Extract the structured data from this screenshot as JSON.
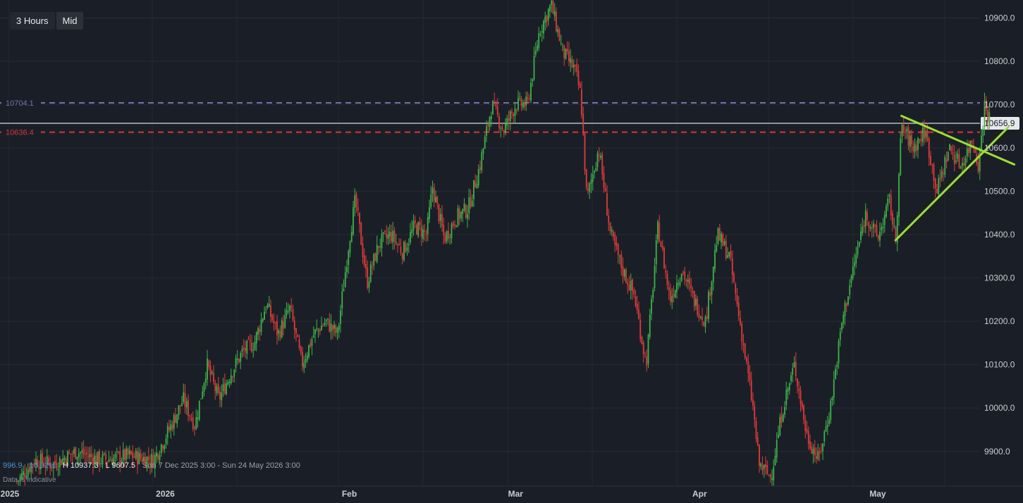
{
  "toolbar": {
    "timeframe": "3 Hours",
    "price_mode": "Mid"
  },
  "stats": {
    "change": "996.9",
    "change_pct": "10.32%",
    "high": "H 10937.3",
    "low": "L 9607.5",
    "range": "Sun 7 Dec 2025 3:00 - Sun 24 May 2026 3:00"
  },
  "note": "Data is indicative",
  "colors": {
    "up": "#3fb24a",
    "down": "#e03b3b",
    "trendline": "#9cde35",
    "purple_line": "#7b6fb0",
    "red_line": "#d63636",
    "background": "#1a1f27"
  },
  "chart_data": {
    "type": "candlestick",
    "ylim": [
      9820,
      10930
    ],
    "y_ticks": [
      9900,
      10000,
      10100,
      10200,
      10300,
      10400,
      10500,
      10600,
      10700,
      10800,
      10900
    ],
    "y_tick_labels": [
      "9900.0",
      "10000.0",
      "10100.0",
      "10200.0",
      "10300.0",
      "10400.0",
      "10500.0",
      "10600.0",
      "10700.0",
      "10800.0",
      "10900.0"
    ],
    "x_labels": [
      {
        "date": "2025-12-07",
        "label": "2025"
      },
      {
        "date": "2026-01-01",
        "label": "2026"
      },
      {
        "date": "2026-02-01",
        "label": "Feb"
      },
      {
        "date": "2026-03-01",
        "label": "Mar"
      },
      {
        "date": "2026-04-01",
        "label": "Apr"
      },
      {
        "date": "2026-05-01",
        "label": "May"
      }
    ],
    "horizontal_levels": [
      {
        "value": 10704.1,
        "label": "10704.1",
        "style": "dashed",
        "color": "#7b6fb0"
      },
      {
        "value": 10636.4,
        "label": "10636.4",
        "style": "dashed",
        "color": "#d63636"
      },
      {
        "value": 10656.9,
        "label": "10656.9",
        "style": "solid",
        "color": "#b8bcc4"
      }
    ],
    "price_path": [
      [
        "2025-12-07",
        9830
      ],
      [
        "2025-12-10",
        9880
      ],
      [
        "2025-12-13",
        9870
      ],
      [
        "2025-12-17",
        9900
      ],
      [
        "2025-12-21",
        9880
      ],
      [
        "2025-12-26",
        9890
      ],
      [
        "2025-12-30",
        9880
      ],
      [
        "2026-01-02",
        9960
      ],
      [
        "2026-01-04",
        10020
      ],
      [
        "2026-01-06",
        9960
      ],
      [
        "2026-01-08",
        10100
      ],
      [
        "2026-01-10",
        10020
      ],
      [
        "2026-01-12",
        10080
      ],
      [
        "2026-01-14",
        10130
      ],
      [
        "2026-01-16",
        10150
      ],
      [
        "2026-01-18",
        10240
      ],
      [
        "2026-01-20",
        10170
      ],
      [
        "2026-01-22",
        10230
      ],
      [
        "2026-01-24",
        10100
      ],
      [
        "2026-01-26",
        10170
      ],
      [
        "2026-01-28",
        10200
      ],
      [
        "2026-01-30",
        10170
      ],
      [
        "2026-02-01",
        10390
      ],
      [
        "2026-02-02",
        10480
      ],
      [
        "2026-02-04",
        10290
      ],
      [
        "2026-02-06",
        10380
      ],
      [
        "2026-02-08",
        10400
      ],
      [
        "2026-02-10",
        10360
      ],
      [
        "2026-02-12",
        10420
      ],
      [
        "2026-02-14",
        10400
      ],
      [
        "2026-02-15",
        10510
      ],
      [
        "2026-02-17",
        10390
      ],
      [
        "2026-02-19",
        10440
      ],
      [
        "2026-02-21",
        10460
      ],
      [
        "2026-02-23",
        10560
      ],
      [
        "2026-02-25",
        10700
      ],
      [
        "2026-02-27",
        10640
      ],
      [
        "2026-03-01",
        10700
      ],
      [
        "2026-03-03",
        10700
      ],
      [
        "2026-03-05",
        10870
      ],
      [
        "2026-03-07",
        10930
      ],
      [
        "2026-03-09",
        10820
      ],
      [
        "2026-03-11",
        10780
      ],
      [
        "2026-03-12",
        10720
      ],
      [
        "2026-03-13",
        10480
      ],
      [
        "2026-03-15",
        10600
      ],
      [
        "2026-03-17",
        10400
      ],
      [
        "2026-03-19",
        10320
      ],
      [
        "2026-03-21",
        10260
      ],
      [
        "2026-03-23",
        10100
      ],
      [
        "2026-03-25",
        10420
      ],
      [
        "2026-03-27",
        10250
      ],
      [
        "2026-03-29",
        10320
      ],
      [
        "2026-03-31",
        10250
      ],
      [
        "2026-04-02",
        10200
      ],
      [
        "2026-04-04",
        10400
      ],
      [
        "2026-04-06",
        10350
      ],
      [
        "2026-04-08",
        10180
      ],
      [
        "2026-04-10",
        10000
      ],
      [
        "2026-04-11",
        9870
      ],
      [
        "2026-04-13",
        9840
      ],
      [
        "2026-04-15",
        10000
      ],
      [
        "2026-04-17",
        10100
      ],
      [
        "2026-04-19",
        9940
      ],
      [
        "2026-04-21",
        9880
      ],
      [
        "2026-04-23",
        10000
      ],
      [
        "2026-04-25",
        10200
      ],
      [
        "2026-04-27",
        10330
      ],
      [
        "2026-04-29",
        10450
      ],
      [
        "2026-05-01",
        10390
      ],
      [
        "2026-05-03",
        10480
      ],
      [
        "2026-05-04",
        10380
      ],
      [
        "2026-05-05",
        10650
      ],
      [
        "2026-05-07",
        10600
      ],
      [
        "2026-05-09",
        10640
      ],
      [
        "2026-05-11",
        10500
      ],
      [
        "2026-05-13",
        10600
      ],
      [
        "2026-05-15",
        10560
      ],
      [
        "2026-05-17",
        10620
      ],
      [
        "2026-05-18",
        10560
      ],
      [
        "2026-05-19",
        10700
      ],
      [
        "2026-05-20",
        10660
      ]
    ],
    "trendlines": [
      {
        "from": [
          "2026-05-05",
          10674
        ],
        "to": [
          "2026-05-24",
          10562
        ]
      },
      {
        "from": [
          "2026-05-04",
          10387
        ],
        "to": [
          "2026-05-23",
          10648
        ]
      }
    ]
  }
}
